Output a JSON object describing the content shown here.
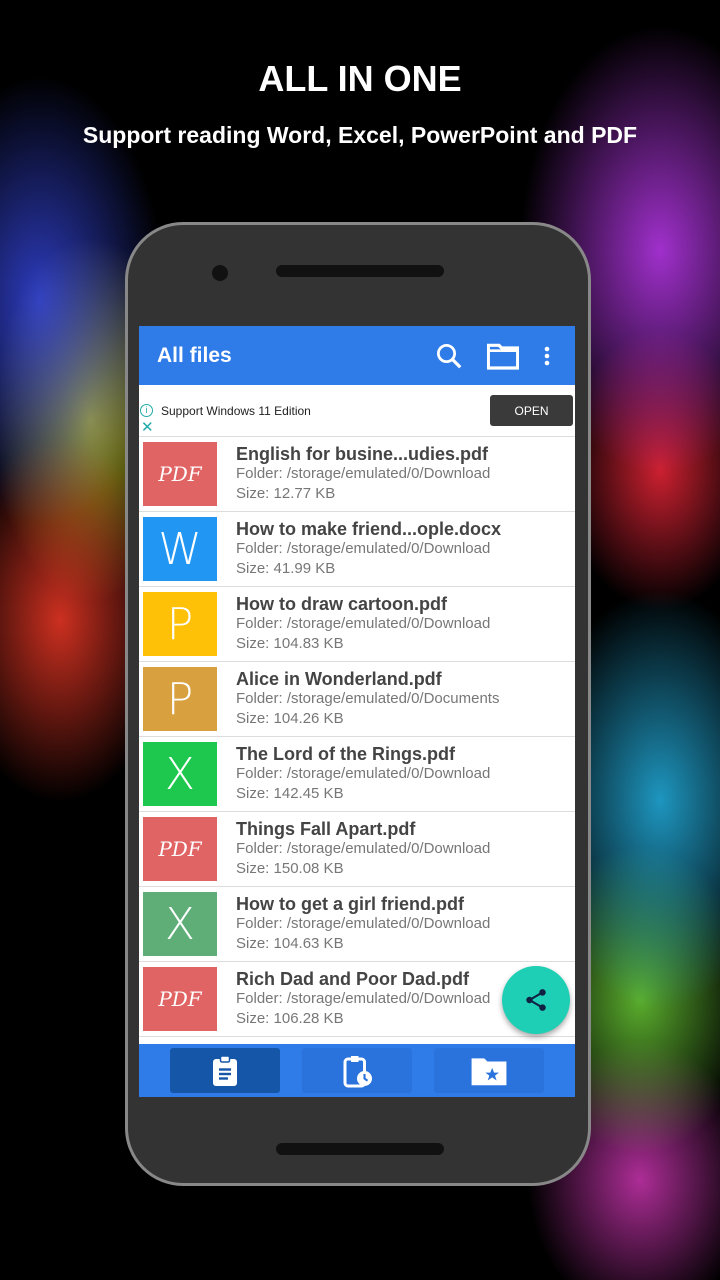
{
  "promo": {
    "title": "ALL IN ONE",
    "subtitle": "Support reading Word, Excel, PowerPoint and PDF"
  },
  "appbar": {
    "title": "All files",
    "icons": [
      "search-icon",
      "folder-icon",
      "more-vert-icon"
    ]
  },
  "ad": {
    "text": "Support Windows 11 Edition",
    "button": "OPEN",
    "info": "i",
    "close": "✕"
  },
  "files": [
    {
      "icon_text": "PDF",
      "color": "#e06464",
      "name": "English for busine...udies.pdf",
      "folder": "Folder: /storage/emulated/0/Download",
      "size": "Size: 12.77 KB"
    },
    {
      "icon_text": "W",
      "color": "#2196f3",
      "name": "How to make friend...ople.docx",
      "folder": "Folder: /storage/emulated/0/Download",
      "size": "Size: 41.99 KB"
    },
    {
      "icon_text": "P",
      "color": "#ffc107",
      "name": "How to draw cartoon.pdf",
      "folder": "Folder: /storage/emulated/0/Download",
      "size": "Size: 104.83 KB"
    },
    {
      "icon_text": "P",
      "color": "#d9a040",
      "name": "Alice in Wonderland.pdf",
      "folder": "Folder: /storage/emulated/0/Documents",
      "size": "Size: 104.26 KB"
    },
    {
      "icon_text": "X",
      "color": "#1ec84e",
      "name": "The Lord of the Rings.pdf",
      "folder": "Folder: /storage/emulated/0/Download",
      "size": "Size: 142.45 KB"
    },
    {
      "icon_text": "PDF",
      "color": "#e06464",
      "name": "Things Fall Apart.pdf",
      "folder": "Folder: /storage/emulated/0/Download",
      "size": "Size: 150.08 KB"
    },
    {
      "icon_text": "X",
      "color": "#5fae78",
      "name": "How to get a girl friend.pdf",
      "folder": "Folder: /storage/emulated/0/Download",
      "size": "Size: 104.63 KB"
    },
    {
      "icon_text": "PDF",
      "color": "#e06464",
      "name": "Rich Dad and Poor Dad.pdf",
      "folder": "Folder: /storage/emulated/0/Download",
      "size": "Size: 106.28 KB"
    }
  ],
  "nav": {
    "tabs": [
      "all-files",
      "recent",
      "favorites"
    ],
    "active": 0
  },
  "colors": {
    "primary": "#2f7be8",
    "fab": "#1ecfb5"
  }
}
